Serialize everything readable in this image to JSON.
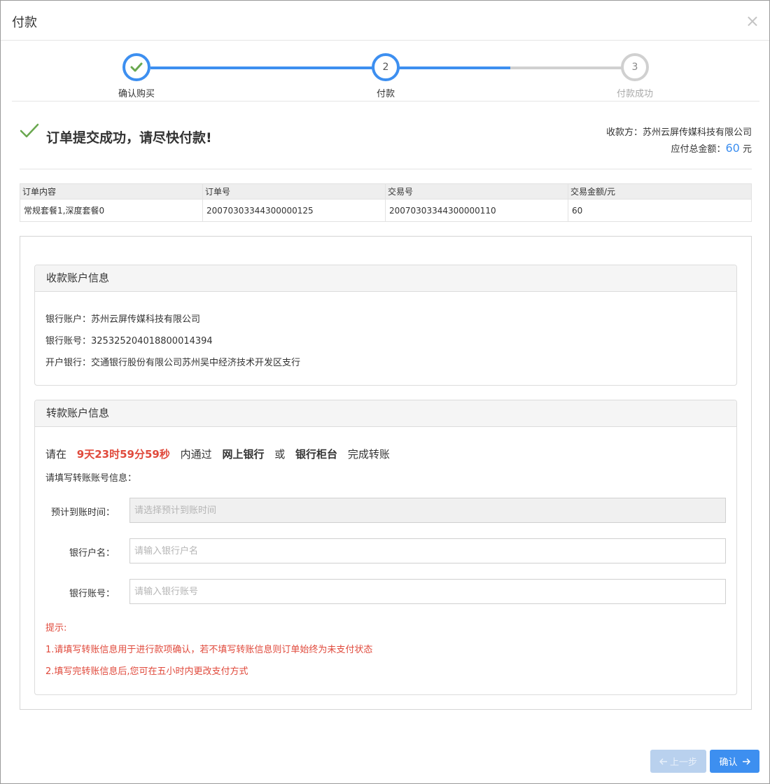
{
  "dialog": {
    "title": "付款",
    "close_glyph": "×"
  },
  "steps": [
    {
      "label": "确认购买",
      "state": "done",
      "number": ""
    },
    {
      "label": "付款",
      "state": "active",
      "number": "2"
    },
    {
      "label": "付款成功",
      "state": "todo",
      "number": "3"
    }
  ],
  "status": {
    "message": "订单提交成功，请尽快付款!",
    "payee_label": "收款方：",
    "payee_name": "苏州云屏传媒科技有限公司",
    "total_label": "应付总金额：",
    "total_amount": "60",
    "total_unit": "元"
  },
  "order_table": {
    "headers": [
      "订单内容",
      "订单号",
      "交易号",
      "交易金额/元"
    ],
    "rows": [
      [
        "常规套餐1,深度套餐0",
        "20070303344300000125",
        "20070303344300000110",
        "60"
      ]
    ]
  },
  "receiving_account": {
    "title": "收款账户信息",
    "bank_account_label": "银行账户：",
    "bank_account": "苏州云屏传媒科技有限公司",
    "account_no_label": "银行账号：",
    "account_no": "325325204018800014394",
    "bank_label": "开户银行：",
    "bank": "交通银行股份有限公司苏州吴中经济技术开发区支行"
  },
  "transfer_account": {
    "title": "转款账户信息",
    "line_prefix": "请在",
    "countdown": "9天23时59分59秒",
    "line_mid": "内通过",
    "method1": "网上银行",
    "or": "或",
    "method2": "银行柜台",
    "line_suffix": "完成转账",
    "fill_hint": "请填写转账账号信息：",
    "fields": [
      {
        "label": "预计到账时间：",
        "placeholder": "请选择预计到账时间",
        "disabled": true
      },
      {
        "label": "银行户名：",
        "placeholder": "请输入银行户名",
        "disabled": false
      },
      {
        "label": "银行账号：",
        "placeholder": "请输入银行账号",
        "disabled": false
      }
    ],
    "tips_title": "提示:",
    "tips": [
      "1.请填写转账信息用于进行款项确认，若不填写转账信息则订单始终为未支付状态",
      "2.填写完转账信息后,您可在五小时内更改支付方式"
    ]
  },
  "buttons": {
    "prev": "上一步",
    "confirm": "确认"
  },
  "colors": {
    "primary": "#3d8ff0",
    "success": "#6aa84f",
    "danger": "#e04a3c",
    "inactive": "#d0d0d0"
  }
}
